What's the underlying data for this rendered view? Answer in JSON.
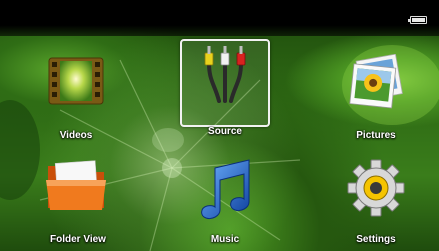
{
  "status": {
    "battery_icon": "battery-icon"
  },
  "menu": {
    "selected": "source",
    "items": [
      {
        "id": "videos",
        "label": "Videos",
        "icon": "film-icon"
      },
      {
        "id": "source",
        "label": "Source",
        "icon": "av-cables-icon"
      },
      {
        "id": "pictures",
        "label": "Pictures",
        "icon": "photos-icon"
      },
      {
        "id": "folder-view",
        "label": "Folder View",
        "icon": "folder-icon"
      },
      {
        "id": "music",
        "label": "Music",
        "icon": "music-note-icon"
      },
      {
        "id": "settings",
        "label": "Settings",
        "icon": "gear-icon"
      }
    ]
  },
  "colors": {
    "status_bar": "#000000",
    "label_text": "#ffffff",
    "selection_border": "#f2f2f2",
    "cable_yellow": "#e8d21e",
    "cable_white": "#f2f2f2",
    "cable_red": "#d8221f",
    "folder_orange": "#f07a1e",
    "music_blue": "#1f63d6",
    "gear_gray": "#d8d8d8",
    "gear_center": "#f5c400"
  }
}
